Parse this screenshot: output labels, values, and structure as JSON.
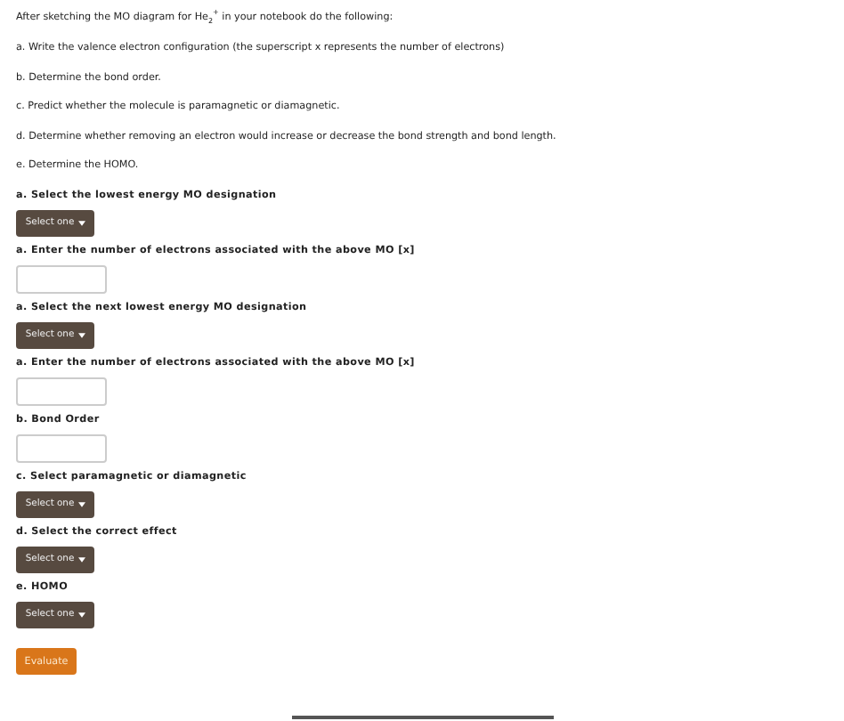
{
  "intro": "After sketching the MO diagram for He$_{2}$$^{+}$ in your notebook do the following:",
  "tasks": [
    "a. Write the valence electron configuration (the superscript x represents the number of electrons)",
    "b. Determine the bond order.",
    "c. Predict whether the molecule is paramagnetic or diamagnetic.",
    "d. Determine whether removing an electron would increase or decrease the bond strength and bond length.",
    "e. Determine the HOMO."
  ],
  "questions": [
    {
      "label": "a. Select the lowest energy MO designation",
      "kind": "dropdown",
      "button": "Select one"
    },
    {
      "label": "a. Enter the number of electrons associated with the above MO [x]",
      "kind": "input"
    },
    {
      "label": "a. Select the next lowest energy MO designation",
      "kind": "dropdown",
      "button": "Select one"
    },
    {
      "label": "a. Enter the number of electrons associated with the above MO [x]",
      "kind": "input"
    },
    {
      "label": "b. Bond Order",
      "kind": "input"
    },
    {
      "label": "c. Select paramagnetic or diamagnetic",
      "kind": "dropdown",
      "button": "Select one"
    },
    {
      "label": "d. Select the correct effect",
      "kind": "dropdown",
      "button": "Select one"
    },
    {
      "label": "e. HOMO",
      "kind": "dropdown",
      "button": "Select one"
    }
  ],
  "submit": "Evaluate"
}
